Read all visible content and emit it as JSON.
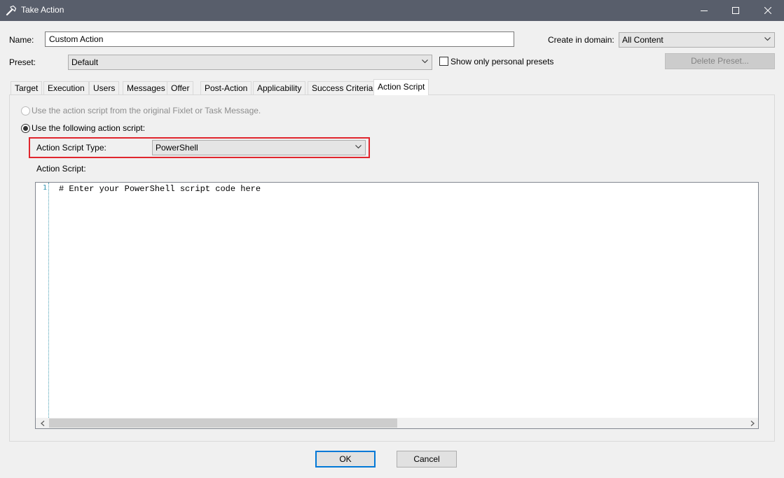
{
  "window": {
    "title": "Take Action",
    "icon": "hammer-icon"
  },
  "form": {
    "name_label": "Name:",
    "name_value": "Custom Action",
    "domain_label": "Create in domain:",
    "domain_value": "All Content",
    "preset_label": "Preset:",
    "preset_value": "Default",
    "personal_presets_label": "Show only personal presets",
    "personal_presets_checked": false,
    "delete_preset_label": "Delete Preset..."
  },
  "tabs": [
    {
      "label": "Target",
      "active": false
    },
    {
      "label": "Execution",
      "active": false
    },
    {
      "label": "Users",
      "active": false
    },
    {
      "label": "Messages",
      "active": false
    },
    {
      "label": "Offer",
      "active": false
    },
    {
      "label": "Post-Action",
      "active": false
    },
    {
      "label": "Applicability",
      "active": false
    },
    {
      "label": "Success Criteria",
      "active": false
    },
    {
      "label": "Action Script",
      "active": true
    }
  ],
  "action_script": {
    "option_original": "Use the action script from the original Fixlet or Task Message.",
    "option_following": "Use the following action script:",
    "selected_option": "following",
    "type_label": "Action Script Type:",
    "type_value": "PowerShell",
    "script_label": "Action Script:",
    "lines": [
      {
        "number": "1",
        "code": "# Enter your PowerShell script code here"
      }
    ]
  },
  "buttons": {
    "ok": "OK",
    "cancel": "Cancel"
  },
  "colors": {
    "titlebar": "#585e6b",
    "highlight": "#e0262d",
    "default_button_border": "#0078d7"
  }
}
